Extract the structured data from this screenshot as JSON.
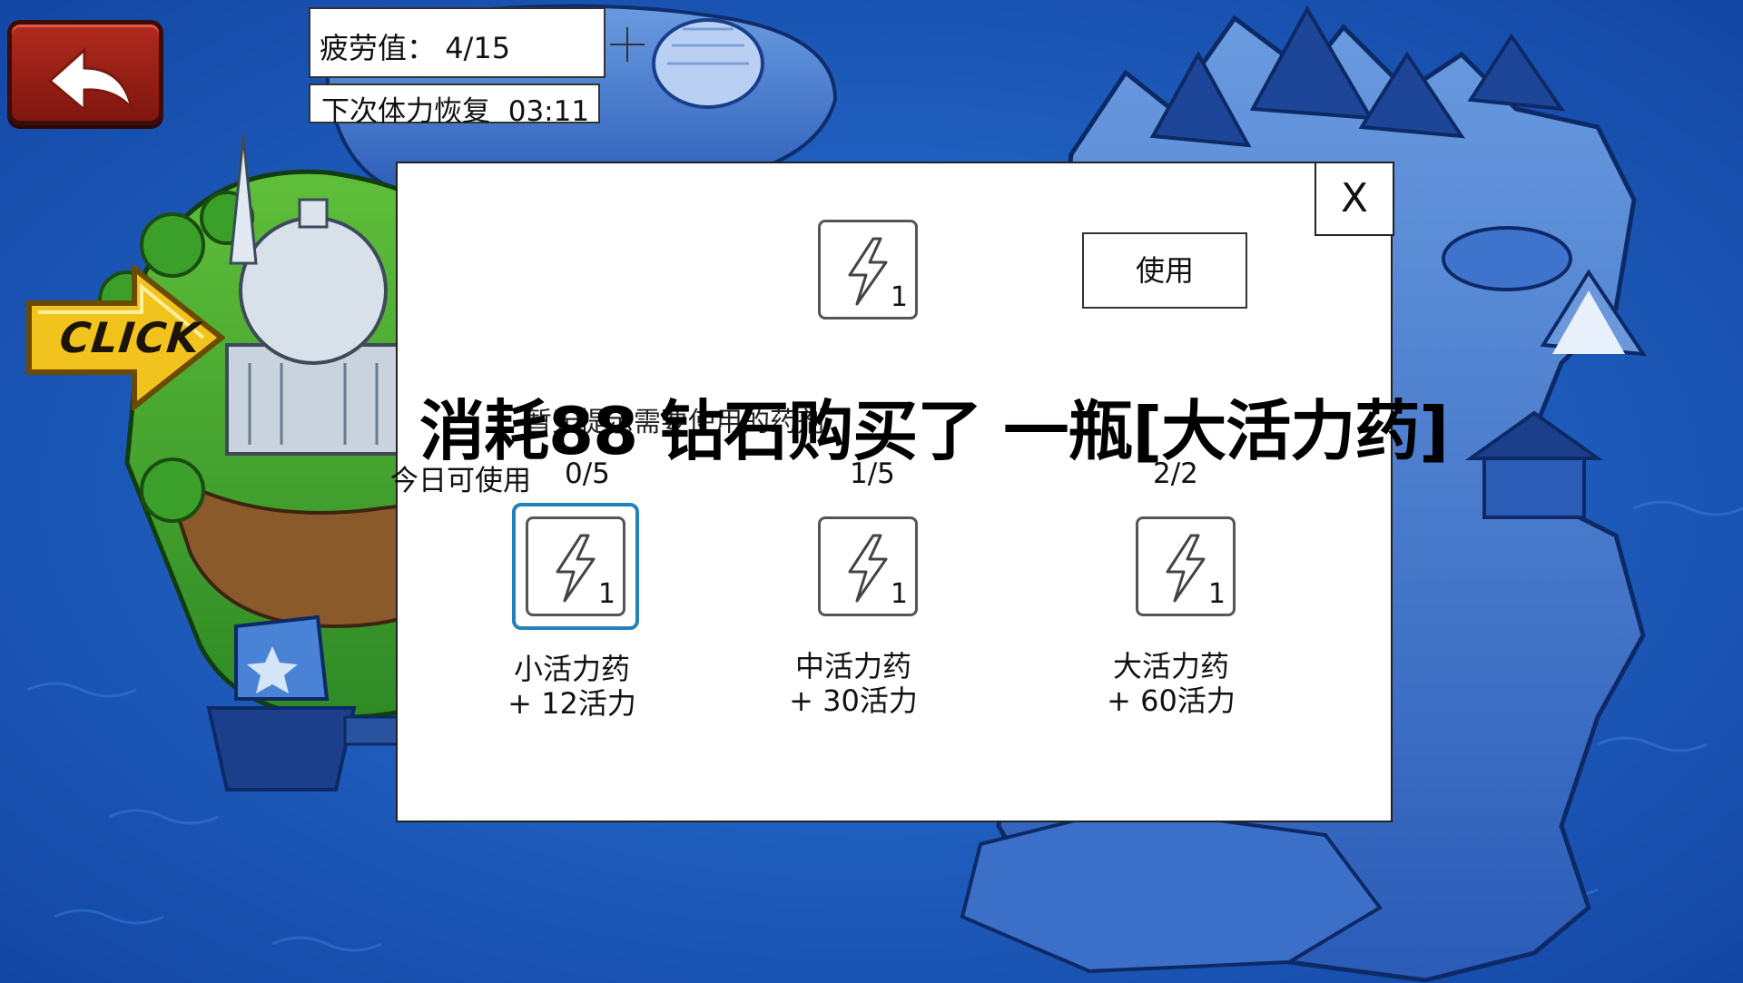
{
  "hud": {
    "fatigue_label": "疲劳值：",
    "fatigue_value": "4/15",
    "recover_label": "下次体力恢复",
    "recover_time": "03:11"
  },
  "map": {
    "click_sign_text": "CLICK"
  },
  "modal": {
    "close_label": "X",
    "use_button_label": "使用",
    "top_slot_count": "1",
    "hint_text": "暂无提示需要使用的药剂",
    "daily_label": "今日可使用",
    "items": [
      {
        "name": "小活力药",
        "effect": "+ 12活力",
        "daily": "0/5",
        "count": "1"
      },
      {
        "name": "中活力药",
        "effect": "+ 30活力",
        "daily": "1/5",
        "count": "1"
      },
      {
        "name": "大活力药",
        "effect": "+ 60活力",
        "daily": "2/2",
        "count": "1"
      }
    ]
  },
  "toast": {
    "message": "消耗88 钻石购买了 一瓶[大活力药]"
  },
  "colors": {
    "ocean": "#1c5fc0",
    "island_dark": "#1a3f8a",
    "back_button": "#9c1f15",
    "click_sign": "#f2c21d",
    "selected_border": "#2680b8"
  },
  "icons": [
    "back-arrow-icon",
    "lightning-icon",
    "plus-icon",
    "close-icon"
  ]
}
